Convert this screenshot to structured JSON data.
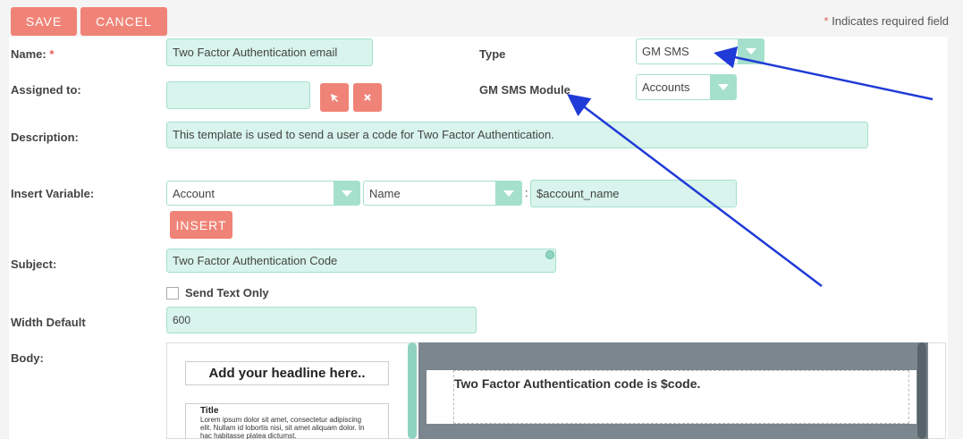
{
  "toolbar": {
    "save_label": "SAVE",
    "cancel_label": "CANCEL"
  },
  "required_note": {
    "star": "*",
    "text": " Indicates required field"
  },
  "form": {
    "name": {
      "label": "Name:",
      "star": "*",
      "value": "Two Factor Authentication email"
    },
    "type": {
      "label": "Type",
      "value": "GM SMS"
    },
    "assigned_to": {
      "label": "Assigned to:",
      "value": ""
    },
    "gm_sms_module": {
      "label": "GM SMS Module",
      "value": "Accounts"
    },
    "description": {
      "label": "Description:",
      "value": "This template is used to send a user a code for Two Factor Authentication."
    },
    "insert_variable": {
      "label": "Insert Variable:",
      "module": "Account",
      "field": "Name",
      "separator": ":",
      "value": "$account_name",
      "insert_label": "INSERT"
    },
    "subject": {
      "label": "Subject:",
      "value": "Two Factor Authentication Code"
    },
    "send_text_only": {
      "label": "Send Text Only",
      "checked": false
    },
    "width_default": {
      "label": "Width Default",
      "value": "600"
    },
    "body": {
      "label": "Body:"
    }
  },
  "editor": {
    "headline": "Add your headline here..",
    "block_title": "Title",
    "block_text": "Lorem ipsum dolor sit amet, consectetur adipiscing elit. Nullam id lobortis nisi, sit amet aliquam dolor. In hac habitasse platea dictumst.",
    "email_text": "Two Factor Authentication code is $code."
  },
  "icons": {
    "select": "cursor-arrow-icon",
    "clear": "close-x-icon"
  },
  "colors": {
    "accent": "#f08377",
    "field_bg": "#d8f4ec",
    "field_border": "#a5e0cd",
    "annotation_arrow": "#1f3ad6"
  }
}
